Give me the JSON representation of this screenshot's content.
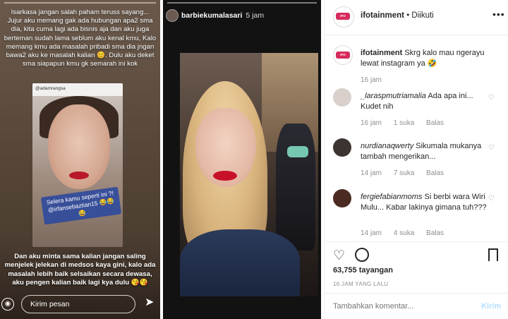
{
  "story1": {
    "top_text": "Isarkasa jangan salah paham teruss sayang... Jujur aku memang gak ada hubungan apa2 sma dia, kita cuma lagi ada bisnis aja dan aku juga berteman sudah lama seblum aku kenal kmu, Kalo memang kmu ada masalah pribadi sma dia jngan bawa2 aku ke masalah kalian 😊. Dulu aku deket sma siapapun kmu gk semarah ini kok",
    "photo_username": "@adamrangsa",
    "sticker_text": "Selera kamu seperti ini ?! @irfansebaztian15 😂😂😂",
    "bottom_text": "Dan aku minta sama kalian jangan saling menjelek jelekan di medsos kaya gini, kalo ada masalah lebih baik selsaikan secara dewasa, aku pengen kalian baik lagi kya dulu 😘😘",
    "reply_placeholder": "Kirim pesan"
  },
  "story2": {
    "username": "barbiekumalasari",
    "time": "5 jam"
  },
  "post": {
    "username": "ifotainment",
    "follow_status": "• Diikuti",
    "caption_user": "ifotainment",
    "caption_text": "Skrg kalo mau ngerayu lewat instagram ya 🤣",
    "caption_time": "16 jam",
    "comments": [
      {
        "user": "_laraspmutriamalia",
        "text": "Ada apa ini... Kudet nih",
        "time": "16 jam",
        "likes": "1 suka",
        "reply": "Balas"
      },
      {
        "user": "nurdianaqwerty",
        "text": "Sikumala mukanya tambah mengerikan...",
        "time": "14 jam",
        "likes": "7 suka",
        "reply": "Balas"
      },
      {
        "user": "fergiefabianmoms",
        "text": "Si berbi wara Wiri Mulu... Kabar lakinya gimana tuh???",
        "time": "14 jam",
        "likes": "4 suka",
        "reply": "Balas"
      }
    ],
    "views": "63,755 tayangan",
    "ago": "16 JAM YANG LALU",
    "add_comment_placeholder": "Tambahkan komentar...",
    "post_button": "Kirim"
  }
}
